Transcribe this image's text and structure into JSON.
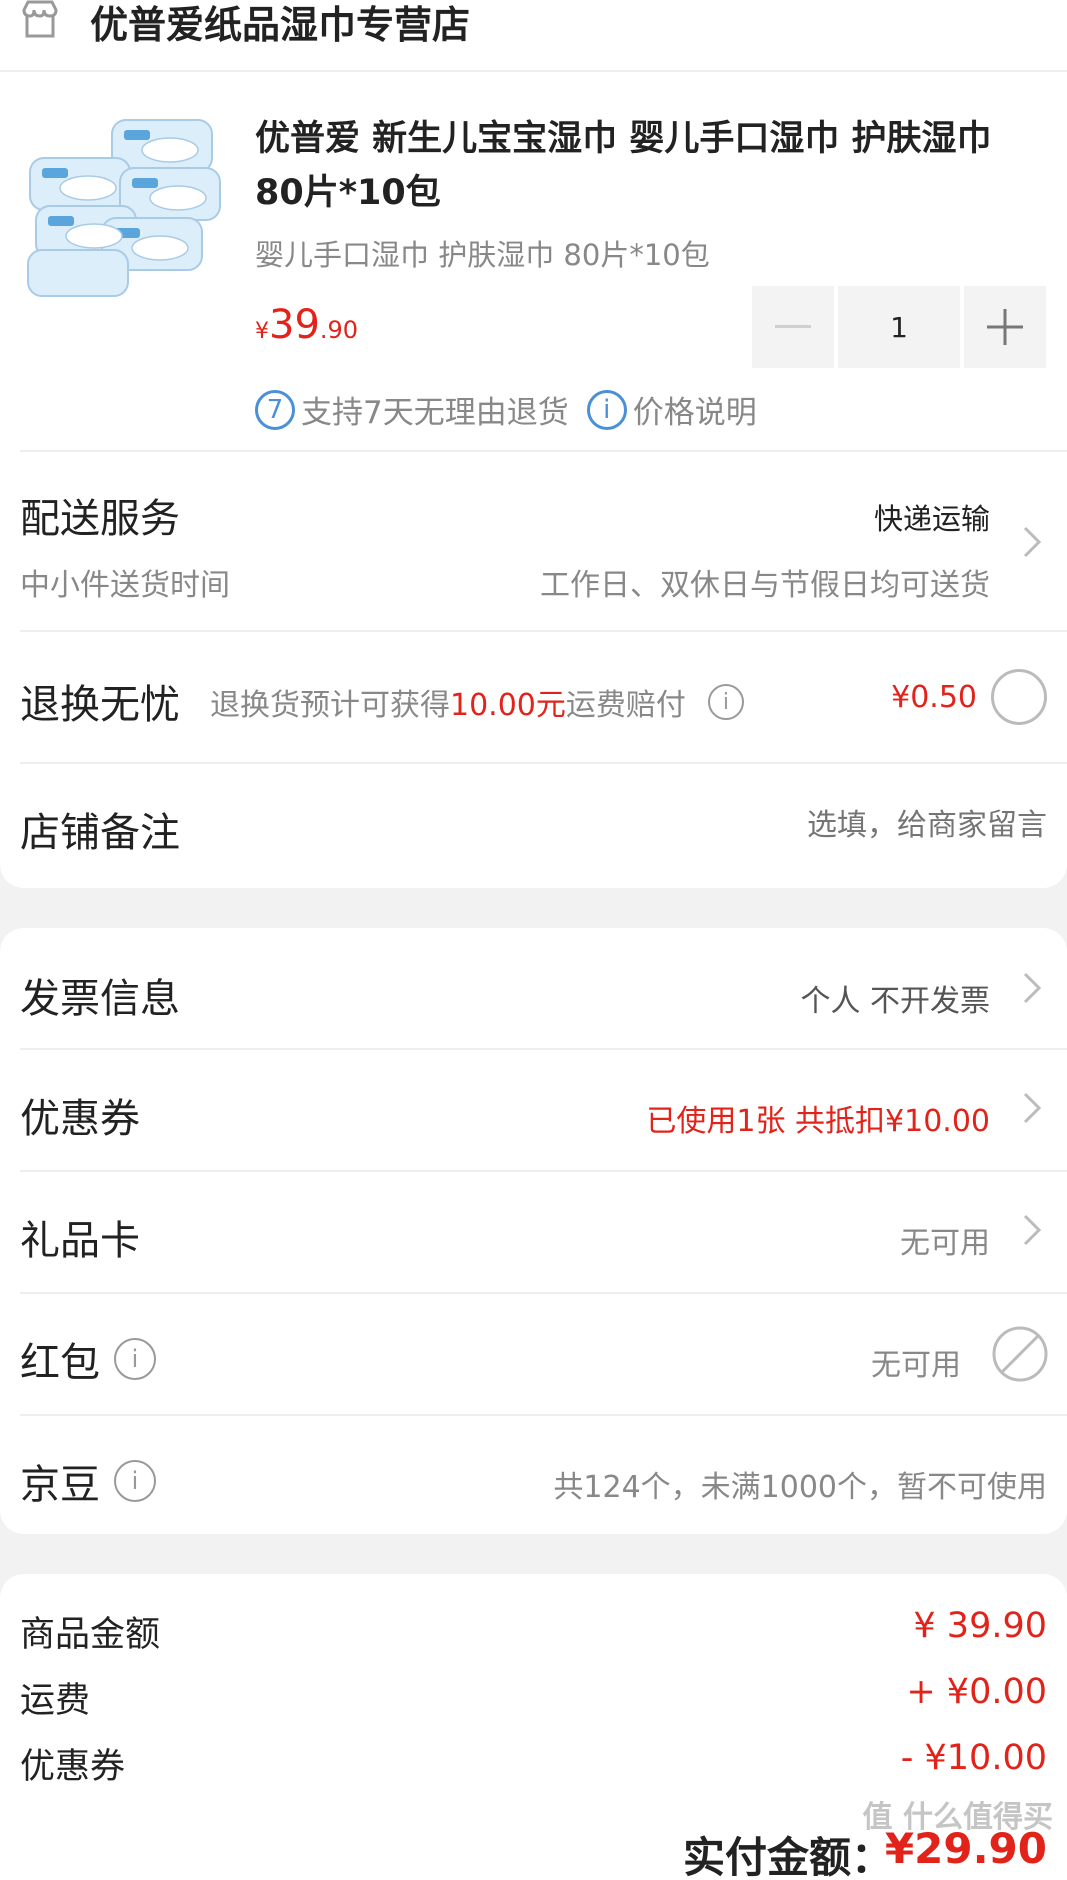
{
  "shop": {
    "name": "优普爱纸品湿巾专营店",
    "icon": "store-icon"
  },
  "product": {
    "title": "优普爱 新生儿宝宝湿巾 婴儿手口湿巾 护肤湿巾 80片*10包",
    "spec": "婴儿手口湿巾 护肤湿巾 80片*10包",
    "price_currency": "¥",
    "price_integer": "39",
    "price_decimal": ".90",
    "quantity": "1",
    "tags": [
      {
        "icon_text": "7",
        "label": "支持7天无理由退货"
      },
      {
        "icon_text": "i",
        "label": "价格说明"
      }
    ]
  },
  "delivery": {
    "label": "配送服务",
    "method": "快递运输",
    "sub_label": "中小件送货时间",
    "sub_value": "工作日、双休日与节假日均可送货"
  },
  "return": {
    "label": "退换无忧",
    "desc_prefix": "退换货预计可获得",
    "desc_amount": "10.00元",
    "desc_suffix": "运费赔付",
    "price": "¥0.50"
  },
  "remark": {
    "label": "店铺备注",
    "placeholder": "选填，给商家留言"
  },
  "invoice": {
    "label": "发票信息",
    "value": "个人 不开发票"
  },
  "coupon": {
    "label": "优惠券",
    "value": "已使用1张 共抵扣¥10.00"
  },
  "gift_card": {
    "label": "礼品卡",
    "value": "无可用"
  },
  "red_packet": {
    "label": "红包",
    "value": "无可用"
  },
  "jingdou": {
    "label": "京豆",
    "value": "共124个，未满1000个，暂不可使用"
  },
  "summary": {
    "items": [
      {
        "label": "商品金额",
        "value": "¥ 39.90"
      },
      {
        "label": "运费",
        "value": "+ ¥0.00"
      },
      {
        "label": "优惠券",
        "value": "- ¥10.00"
      }
    ],
    "total_label": "实付金额：",
    "total_value": "¥29.90"
  },
  "watermark": "值 什么值得买",
  "colors": {
    "accent": "#e2231a",
    "info_blue": "#4a90d9"
  }
}
